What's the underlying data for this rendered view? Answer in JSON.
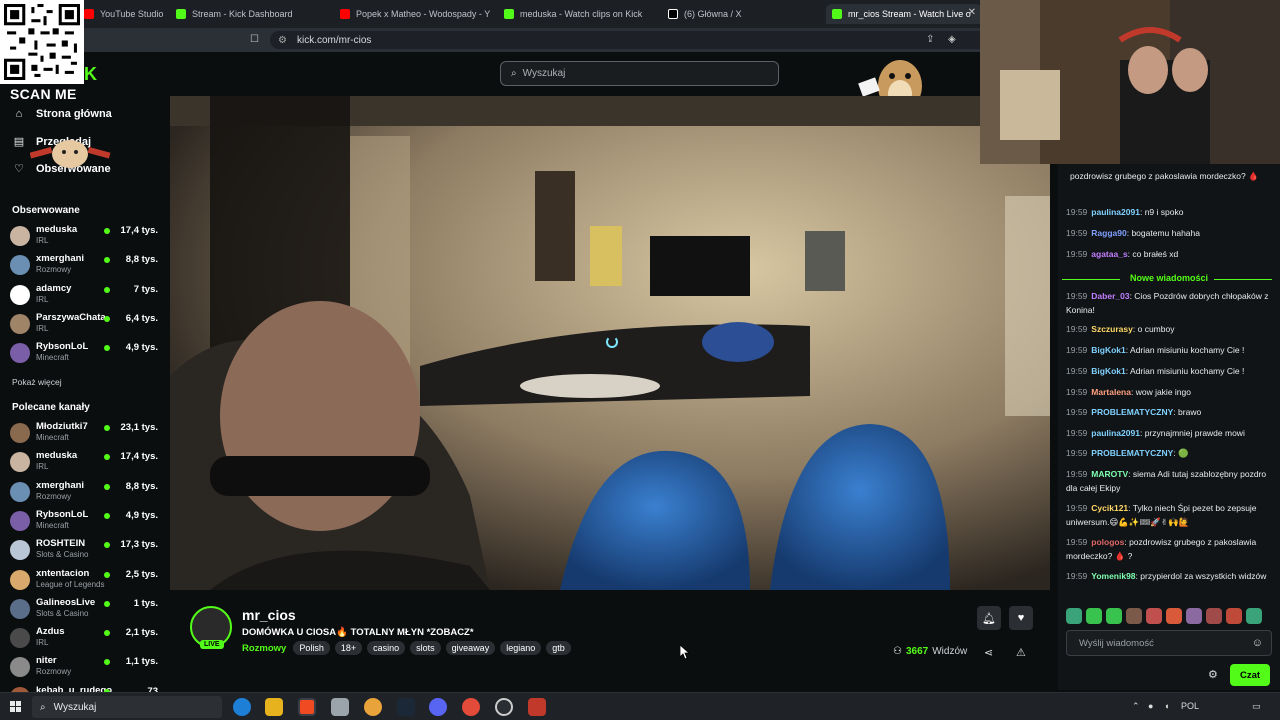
{
  "browser": {
    "tabs": [
      {
        "label": "YouTube Studio",
        "color": "#ff0000"
      },
      {
        "label": "Stream - Kick Dashboard",
        "color": "#53fc18"
      },
      {
        "label": "Popek x Matheo - Wodospady - Y",
        "color": "#ff0000"
      },
      {
        "label": "meduska - Watch clips on Kick",
        "color": "#53fc18"
      },
      {
        "label": "(6) Główna / X",
        "color": "#ffffff"
      },
      {
        "label": "mr_cios Stream - Watch Live o",
        "color": "#53fc18"
      }
    ],
    "url": "kick.com/mr-cios"
  },
  "overlay": {
    "scan_me": "SCAN ME"
  },
  "sidebar": {
    "nav": [
      {
        "label": "Strona główna",
        "icon": "home-icon"
      },
      {
        "label": "Przeglądaj",
        "icon": "browse-icon"
      },
      {
        "label": "Obserwowane",
        "icon": "heart-icon"
      }
    ],
    "followed_title": "Obserwowane",
    "followed": [
      {
        "name": "meduska",
        "category": "IRL",
        "viewers": "17,4 tys.",
        "color": "#c8b4a0"
      },
      {
        "name": "xmerghani",
        "category": "Rozmowy",
        "viewers": "8,8 tys.",
        "color": "#6b8fb3"
      },
      {
        "name": "adamcy",
        "category": "IRL",
        "viewers": "7 tys.",
        "color": "#ffffff"
      },
      {
        "name": "ParszywaChata",
        "category": "IRL",
        "viewers": "6,4 tys.",
        "color": "#a08468"
      },
      {
        "name": "RybsonLoL",
        "category": "Minecraft",
        "viewers": "4,9 tys.",
        "color": "#7a5ea8"
      }
    ],
    "show_more": "Pokaż więcej",
    "recommended_title": "Polecane kanały",
    "recommended": [
      {
        "name": "Młodziutki7",
        "category": "Minecraft",
        "viewers": "23,1 tys.",
        "color": "#8a6a4e"
      },
      {
        "name": "meduska",
        "category": "IRL",
        "viewers": "17,4 tys.",
        "color": "#c8b4a0"
      },
      {
        "name": "xmerghani",
        "category": "Rozmowy",
        "viewers": "8,8 tys.",
        "color": "#6b8fb3"
      },
      {
        "name": "RybsonLoL",
        "category": "Minecraft",
        "viewers": "4,9 tys.",
        "color": "#7a5ea8"
      },
      {
        "name": "ROSHTEIN",
        "category": "Slots & Casino",
        "viewers": "17,3 tys.",
        "color": "#b9c6d6"
      },
      {
        "name": "xntentacion",
        "category": "League of Legends",
        "viewers": "2,5 tys.",
        "color": "#d9a86c"
      },
      {
        "name": "GalineosLive",
        "category": "Slots & Casino",
        "viewers": "1 tys.",
        "color": "#5a6e8a"
      },
      {
        "name": "Azdus",
        "category": "IRL",
        "viewers": "2,1 tys.",
        "color": "#4a4a4a"
      },
      {
        "name": "niter",
        "category": "Rozmowy",
        "viewers": "1,1 tys.",
        "color": "#8a8a8a"
      },
      {
        "name": "kebab_u_rudego",
        "category": "",
        "viewers": "73",
        "color": "#a05a3a"
      }
    ]
  },
  "search": {
    "placeholder": "Wyszukaj"
  },
  "stream": {
    "streamer": "mr_cios",
    "live": "LIVE",
    "title": "DOMÓWKA U CIOSA🔥 TOTALNY MŁYN *ZOBACZ*",
    "category": "Rozmowy",
    "tags": [
      "Polish",
      "18+",
      "casino",
      "slots",
      "giveaway",
      "legiano",
      "gtb"
    ],
    "viewer_count": "3667",
    "viewer_label": "Widzów"
  },
  "chat": {
    "messages_before": [
      {
        "time": "",
        "user": "",
        "color": "#e06666",
        "text": "pozdrowisz grubego z pakoslawia mordeczko? 🩸"
      },
      {
        "time": "19:59",
        "user": "paulina2091",
        "color": "#7fd1ff",
        "text": "n9 i spoko"
      },
      {
        "time": "19:59",
        "user": "Ragga90",
        "color": "#7f9fff",
        "text": "bogatemu hahaha"
      },
      {
        "time": "19:59",
        "user": "agataa_s",
        "color": "#c27fff",
        "text": "co brałeś xd"
      }
    ],
    "new_messages_label": "Nowe wiadomości",
    "messages_after": [
      {
        "time": "19:59",
        "user": "Daber_03",
        "color": "#c27fff",
        "text": "Cios Pozdrów dobrych chłopaków z Konina!"
      },
      {
        "time": "19:59",
        "user": "Szczurasy",
        "color": "#ffd966",
        "text": "o cumboy"
      },
      {
        "time": "19:59",
        "user": "BigKok1",
        "color": "#7fd1ff",
        "text": "Adrian misiuniu kochamy Cie !"
      },
      {
        "time": "19:59",
        "user": "BigKok1",
        "color": "#7fd1ff",
        "text": "Adrian misiuniu kochamy Cie !"
      },
      {
        "time": "19:59",
        "user": "Martalena",
        "color": "#ff9f7f",
        "text": "wow jakie ingo"
      },
      {
        "time": "19:59",
        "user": "PROBLEMATYCZNY",
        "color": "#7fd1ff",
        "text": "brawo"
      },
      {
        "time": "19:59",
        "user": "paulina2091",
        "color": "#7fd1ff",
        "text": "przynajmniej prawde mowi"
      },
      {
        "time": "19:59",
        "user": "PROBLEMATYCZNY",
        "color": "#7fd1ff",
        "text": "🟢"
      },
      {
        "time": "19:59",
        "user": "MAROTV",
        "color": "#7fffb0",
        "text": "siema Adi tutaj szablozębny pozdro dla całej Ekipy"
      },
      {
        "time": "19:59",
        "user": "Cycik121",
        "color": "#ffd966",
        "text": "Tylko niech Śpi pezet bo zepsuje uniwersum.😄💪✨🎟🚀✌🙌🙋"
      },
      {
        "time": "19:59",
        "user": "pologos",
        "color": "#e06666",
        "text": "pozdrowisz grubego z pakoslawia mordeczko? 🩸 ?"
      },
      {
        "time": "19:59",
        "user": "Yomenik98",
        "color": "#7fffb0",
        "text": "przypierdol za wszystkich widzów"
      }
    ],
    "input_placeholder": "Wyślij wiadomość",
    "send_label": "Czat"
  },
  "taskbar": {
    "search": "Wyszukaj",
    "lang": "POL"
  }
}
